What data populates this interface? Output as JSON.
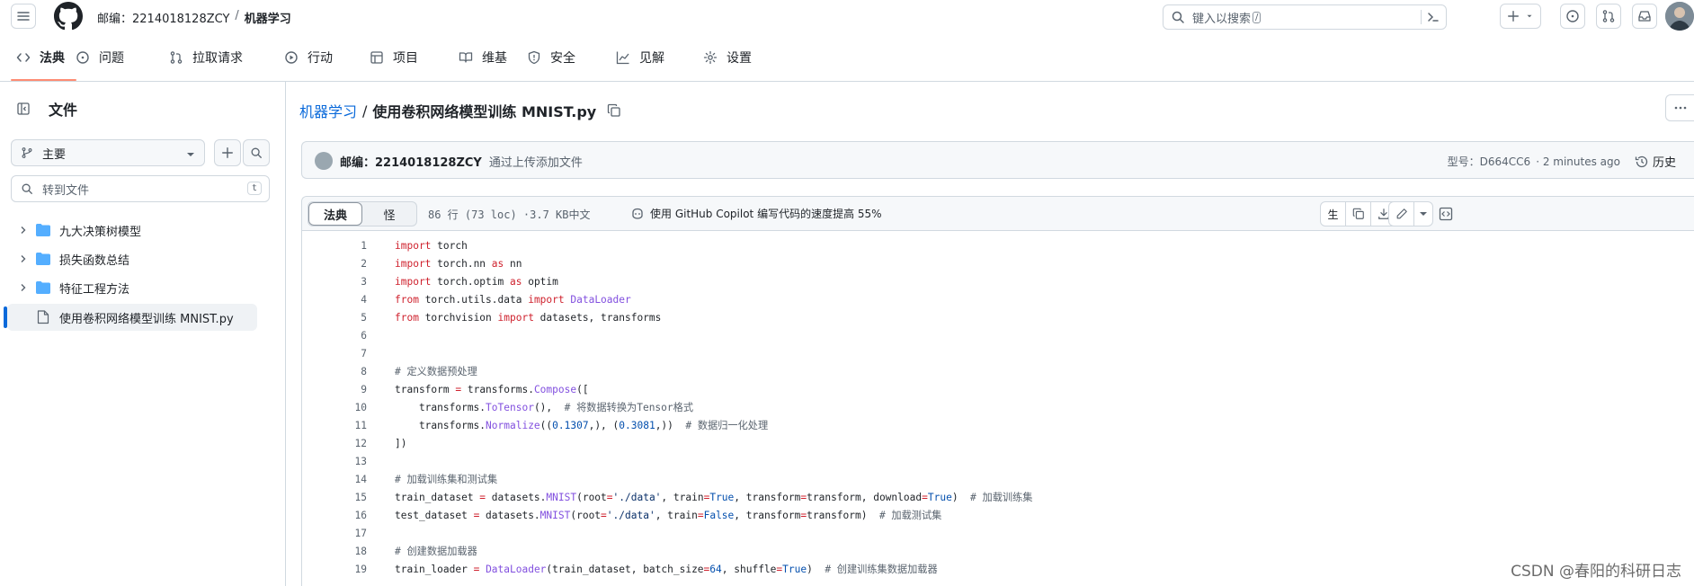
{
  "header": {
    "owner": "邮编：2214018128ZCY",
    "separator": "/",
    "repo": "机器学习",
    "search_placeholder": "键入以搜索",
    "search_kbd": "/"
  },
  "repo_nav": {
    "items": [
      {
        "label": "法典",
        "icon": "code-icon",
        "active": true
      },
      {
        "label": "问题",
        "icon": "issue-icon"
      },
      {
        "label": "拉取请求",
        "icon": "pull-request-icon"
      },
      {
        "label": "行动",
        "icon": "play-icon"
      },
      {
        "label": "项目",
        "icon": "table-icon"
      },
      {
        "label": "维基",
        "icon": "book-icon"
      },
      {
        "label": "安全",
        "icon": "shield-icon"
      },
      {
        "label": "见解",
        "icon": "graph-icon"
      },
      {
        "label": "设置",
        "icon": "gear-icon"
      }
    ],
    "accent": "#fd8c73"
  },
  "sidebar": {
    "title": "文件",
    "branch": "主要",
    "goto_placeholder": "转到文件",
    "goto_kbd": "t",
    "tree": [
      {
        "label": "九大决策树模型",
        "type": "folder"
      },
      {
        "label": "损失函数总结",
        "type": "folder"
      },
      {
        "label": "特征工程方法",
        "type": "folder"
      },
      {
        "label": "使用卷积网络模型训练 MNIST.py",
        "type": "file",
        "selected": true
      }
    ]
  },
  "file": {
    "repo_link": "机器学习",
    "sep": "/",
    "name": "使用卷积网络模型训练 MNIST.py",
    "commit": {
      "author": "邮编：2214018128ZCY",
      "message": "通过上传添加文件",
      "hash_label": "型号：D664CC6",
      "time": "· 2 minutes ago",
      "history": "历史"
    },
    "view_tabs": [
      "法典",
      "怪"
    ],
    "meta": "86 行 (73 loc) ·3.7 KB中文",
    "copilot": "使用 GitHub Copilot 编写代码的速度提高 55%",
    "raw_label": "生"
  },
  "code": [
    {
      "n": "1",
      "html": "<span class=\"kw\">import</span> torch"
    },
    {
      "n": "2",
      "html": "<span class=\"kw\">import</span> torch.nn <span class=\"kw\">as</span> nn"
    },
    {
      "n": "3",
      "html": "<span class=\"kw\">import</span> torch.optim <span class=\"kw\">as</span> optim"
    },
    {
      "n": "4",
      "html": "<span class=\"kw\">from</span> torch.utils.data <span class=\"kw\">import</span> <span class=\"fn\">DataLoader</span>"
    },
    {
      "n": "5",
      "html": "<span class=\"kw\">from</span> torchvision <span class=\"kw\">import</span> datasets, transforms"
    },
    {
      "n": "6",
      "html": ""
    },
    {
      "n": "7",
      "html": ""
    },
    {
      "n": "8",
      "html": "<span class=\"cmt\"># 定义数据预处理</span>"
    },
    {
      "n": "9",
      "html": "transform <span class=\"kw\">=</span> transforms.<span class=\"fn\">Compose</span>(["
    },
    {
      "n": "10",
      "html": "    transforms.<span class=\"fn\">ToTensor</span>(),  <span class=\"cmt\"># 将数据转换为Tensor格式</span>"
    },
    {
      "n": "11",
      "html": "    transforms.<span class=\"fn\">Normalize</span>((<span class=\"num\">0.1307</span>,), (<span class=\"num\">0.3081</span>,))  <span class=\"cmt\"># 数据归一化处理</span>"
    },
    {
      "n": "12",
      "html": "])"
    },
    {
      "n": "13",
      "html": ""
    },
    {
      "n": "14",
      "html": "<span class=\"cmt\"># 加载训练集和测试集</span>"
    },
    {
      "n": "15",
      "html": "train_dataset <span class=\"kw\">=</span> datasets.<span class=\"fn\">MNIST</span>(root<span class=\"kw\">=</span><span class=\"str\">'./data'</span>, train<span class=\"kw\">=</span><span class=\"bi\">True</span>, transform<span class=\"kw\">=</span>transform, download<span class=\"kw\">=</span><span class=\"bi\">True</span>)  <span class=\"cmt\"># 加载训练集</span>"
    },
    {
      "n": "16",
      "html": "test_dataset <span class=\"kw\">=</span> datasets.<span class=\"fn\">MNIST</span>(root<span class=\"kw\">=</span><span class=\"str\">'./data'</span>, train<span class=\"kw\">=</span><span class=\"bi\">False</span>, transform<span class=\"kw\">=</span>transform)  <span class=\"cmt\"># 加载测试集</span>"
    },
    {
      "n": "17",
      "html": ""
    },
    {
      "n": "18",
      "html": "<span class=\"cmt\"># 创建数据加载器</span>"
    },
    {
      "n": "19",
      "html": "train_loader <span class=\"kw\">=</span> <span class=\"fn\">DataLoader</span>(train_dataset, batch_size<span class=\"kw\">=</span><span class=\"num\">64</span>, shuffle<span class=\"kw\">=</span><span class=\"bi\">True</span>)  <span class=\"cmt\"># 创建训练集数据加载器</span>"
    }
  ],
  "watermark": "CSDN @春阳的科研日志"
}
